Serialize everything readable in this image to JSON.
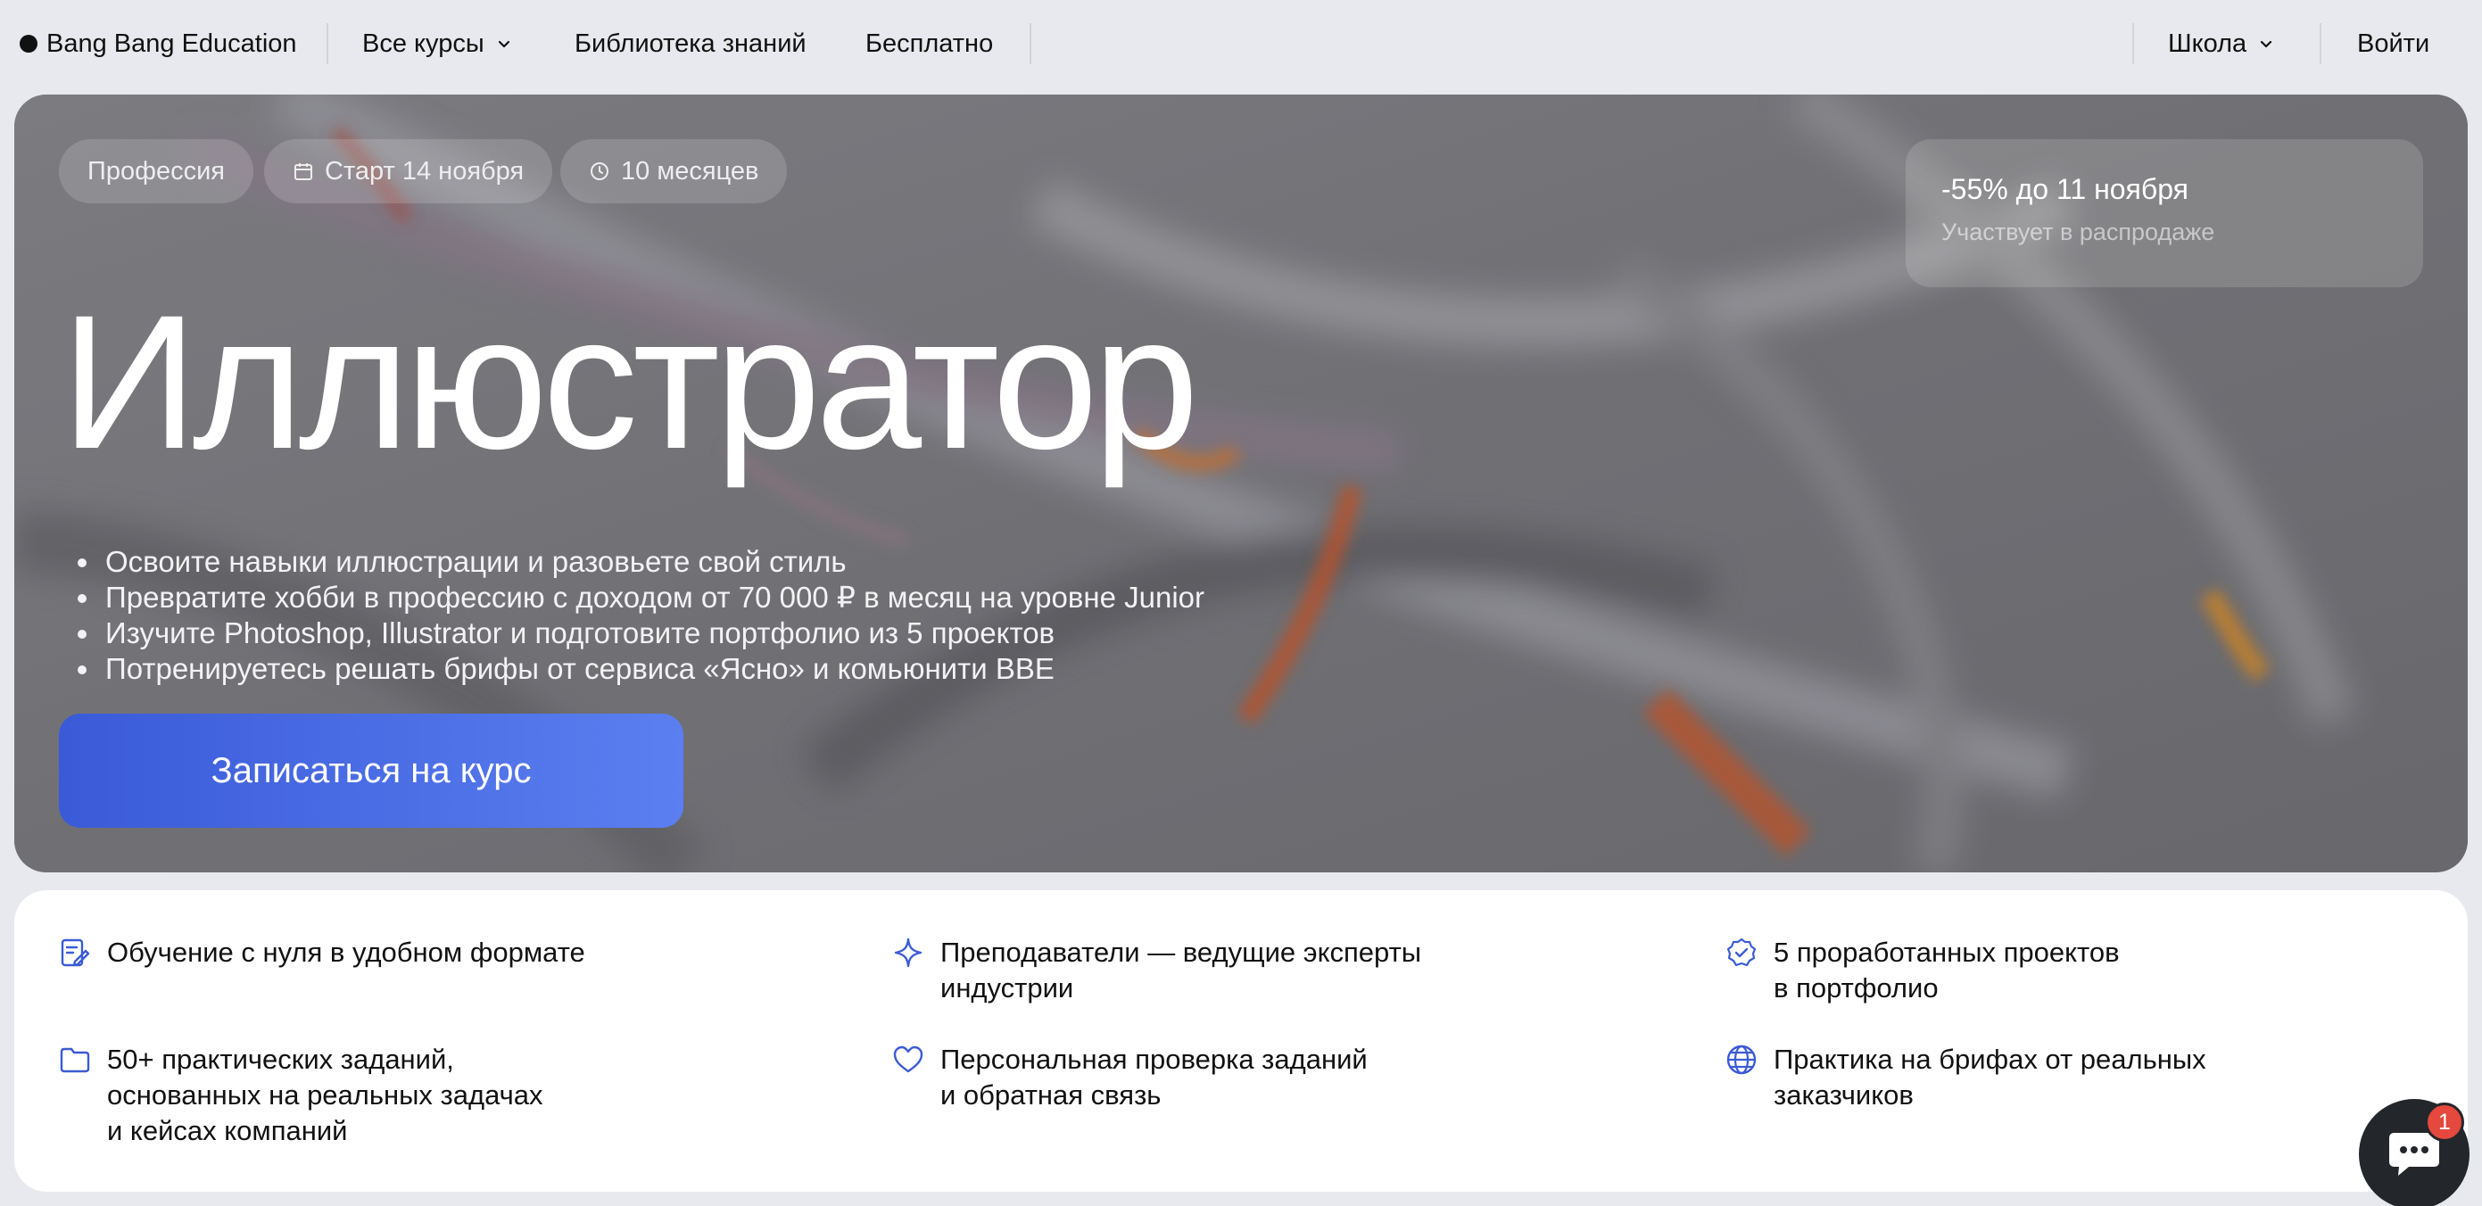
{
  "nav": {
    "brand": "Bang Bang Education",
    "courses": "Все курсы",
    "library": "Библиотека знаний",
    "free": "Бесплатно",
    "school": "Школа",
    "login": "Войти"
  },
  "hero": {
    "chips": {
      "profession": "Профессия",
      "start": "Старт 14 ноября",
      "duration": "10 месяцев"
    },
    "title": "Иллюстратор",
    "bullets": [
      "Освоите навыки иллюстрации и разовьете свой стиль",
      "Превратите хобби в профессию с доходом от 70 000 ₽ в месяц на уровне Junior",
      "Изучите Photoshop, Illustrator и подготовите портфолио из 5 проектов",
      "Потренируетесь решать брифы от сервиса «Ясно» и комьюнити BBE"
    ],
    "cta": "Записаться на курс",
    "sale": {
      "title": "-55% до 11 ноября",
      "subtitle": "Участвует в распродаже"
    }
  },
  "features": [
    {
      "icon": "edit-note-icon",
      "text": "Обучение с нуля в удобном формате"
    },
    {
      "icon": "sparkle-icon",
      "text": "Преподаватели — ведущие эксперты\nиндустрии"
    },
    {
      "icon": "check-badge-icon",
      "text": "5 проработанных проектов\nв портфолио"
    },
    {
      "icon": "folder-icon",
      "text": "50+ практических заданий,\nоснованных на реальных задачах\nи кейсах компаний"
    },
    {
      "icon": "heart-icon",
      "text": "Персональная проверка заданий\nи обратная связь"
    },
    {
      "icon": "globe-icon",
      "text": "Практика на брифах от реальных\nзаказчиков"
    }
  ],
  "chat": {
    "badge": "1"
  },
  "colors": {
    "accent": "#3a5ad8",
    "accent_light": "#5b7ff0",
    "icon_blue": "#3b5bd6",
    "badge": "#e5483d"
  }
}
